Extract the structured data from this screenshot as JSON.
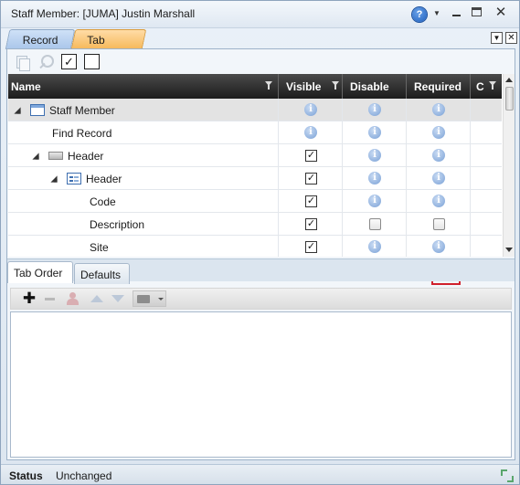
{
  "window": {
    "title": "Staff Member: [JUMA] Justin Marshall",
    "help_symbol": "?",
    "close_symbol": "✕"
  },
  "top_tabs": [
    {
      "label": "Record"
    },
    {
      "label": "Tab Order"
    }
  ],
  "toolbar1": {
    "check_all_symbol": "✓"
  },
  "grid": {
    "columns": {
      "name": "Name",
      "visible": "Visible",
      "disable": "Disable",
      "required": "Required",
      "extra": "C"
    },
    "rows": [
      {
        "label": "Staff Member",
        "level": 0,
        "icon": "form-icon",
        "expander": true,
        "visible": "info",
        "disable": "info",
        "required": "info"
      },
      {
        "label": "Find Record",
        "level": 1,
        "icon": "",
        "expander": false,
        "visible": "info",
        "disable": "info",
        "required": "info"
      },
      {
        "label": "Header",
        "level": 1,
        "icon": "header-icon",
        "expander": true,
        "visible": "checked",
        "disable": "info",
        "required": "info"
      },
      {
        "label": "Header",
        "level": 2,
        "icon": "subform-icon",
        "expander": true,
        "visible": "checked",
        "disable": "info",
        "required": "info"
      },
      {
        "label": "Code",
        "level": 3,
        "icon": "",
        "expander": false,
        "visible": "checked",
        "disable": "info",
        "required": "info"
      },
      {
        "label": "Description",
        "level": 3,
        "icon": "",
        "expander": false,
        "visible": "checked",
        "disable": "unchecked",
        "required": "unchecked"
      },
      {
        "label": "Site",
        "level": 3,
        "icon": "",
        "expander": false,
        "visible": "checked",
        "disable": "info",
        "required": "info"
      }
    ]
  },
  "lower_tabs": [
    {
      "label": "Tab Order"
    },
    {
      "label": "Defaults"
    }
  ],
  "lower_toolbar": {
    "add_symbol": "✚"
  },
  "status": {
    "label": "Status",
    "value": "Unchanged"
  }
}
